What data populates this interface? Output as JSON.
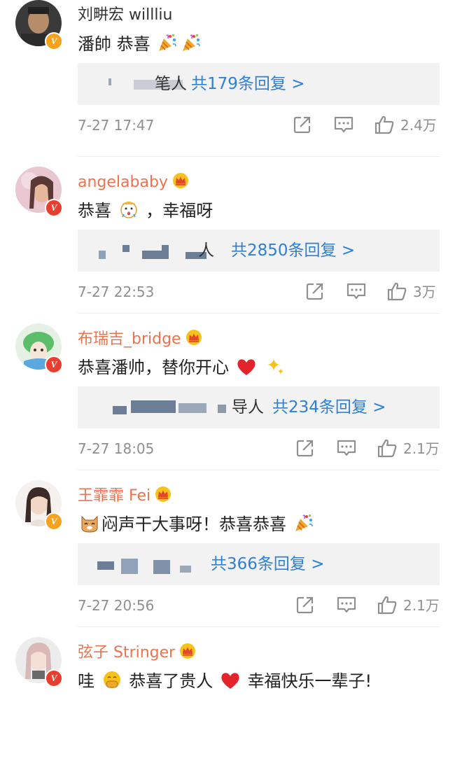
{
  "comments": [
    {
      "name": "刘畊宏 willliu",
      "text": "潘帥 恭喜",
      "reply_tail": "笔人",
      "reply_link": "共179条回复 >",
      "time": "7-27 17:47",
      "likes": "2.4万"
    },
    {
      "name": "angelababy",
      "text_a": "恭喜",
      "text_b": "，幸福呀",
      "reply_tail": "人",
      "reply_link": "共2850条回复 >",
      "time": "7-27 22:53",
      "likes": "3万"
    },
    {
      "name": "布瑞吉_bridge",
      "text": "恭喜潘帅，替你开心",
      "reply_tail": "导人",
      "reply_link": "共234条回复 >",
      "time": "7-27 18:05",
      "likes": "2.1万"
    },
    {
      "name": "王霏霏 Fei",
      "text": "闷声干大事呀！恭喜恭喜",
      "reply_link": "共366条回复 >",
      "time": "7-27 20:56",
      "likes": "2.1万"
    },
    {
      "name": "弦子 Stringer",
      "text_a": "哇",
      "text_b": "恭喜了贵人",
      "text_c": "幸福快乐一辈子!"
    }
  ],
  "colors": {
    "link": "#2f7fd4",
    "vip_name": "#eb7350",
    "verified_orange": "#f6a21c",
    "verified_red": "#ea3d2e"
  },
  "icons": [
    "repost-icon",
    "comment-icon",
    "like-icon",
    "crown-icon",
    "verified-badge",
    "party-popper-emoji",
    "heart-emoji",
    "sparkles-emoji",
    "cat-emoji",
    "hushed-emoji"
  ]
}
